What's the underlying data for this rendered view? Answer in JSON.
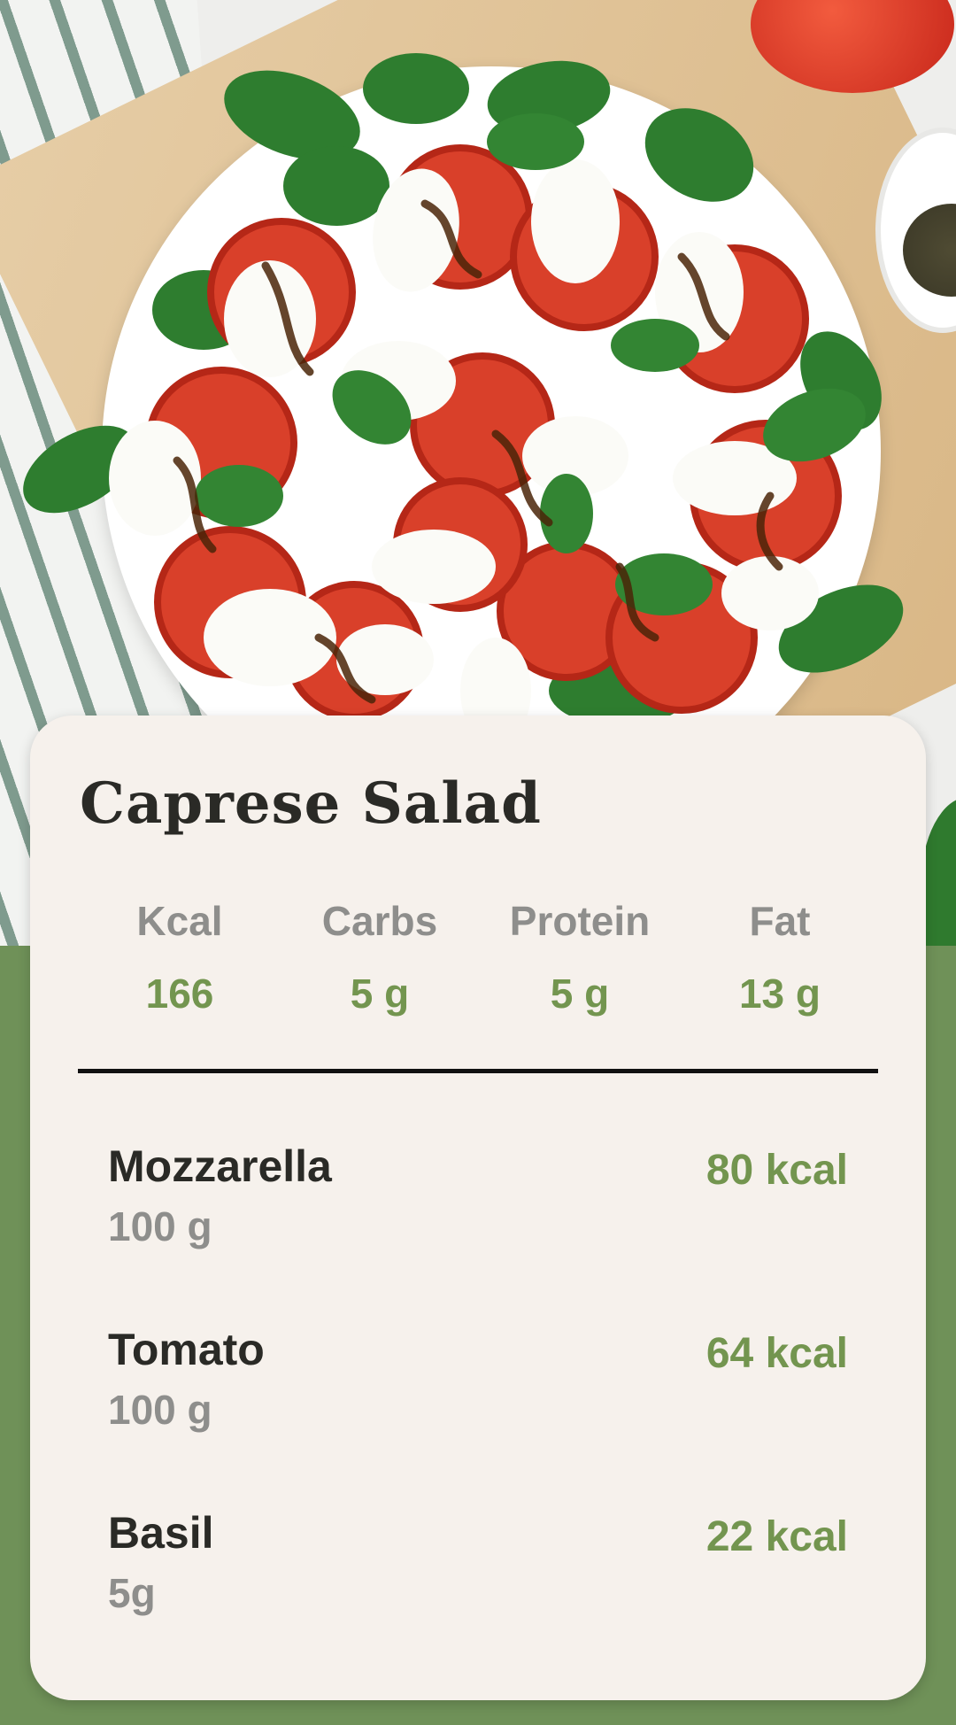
{
  "recipe": {
    "title": "Caprese Salad"
  },
  "nutrition": [
    {
      "label": "Kcal",
      "value": "166"
    },
    {
      "label": "Carbs",
      "value": "5 g"
    },
    {
      "label": "Protein",
      "value": "5 g"
    },
    {
      "label": "Fat",
      "value": "13 g"
    }
  ],
  "ingredients": [
    {
      "name": "Mozzarella",
      "amount": "100 g",
      "kcal": "80 kcal"
    },
    {
      "name": "Tomato",
      "amount": "100 g",
      "kcal": "64 kcal"
    },
    {
      "name": "Basil",
      "amount": "5g",
      "kcal": "22 kcal"
    }
  ],
  "colors": {
    "background": "#6f9158",
    "card": "#f6f1ec",
    "accent_green": "#73954f",
    "label_gray": "#8e8e8c"
  }
}
